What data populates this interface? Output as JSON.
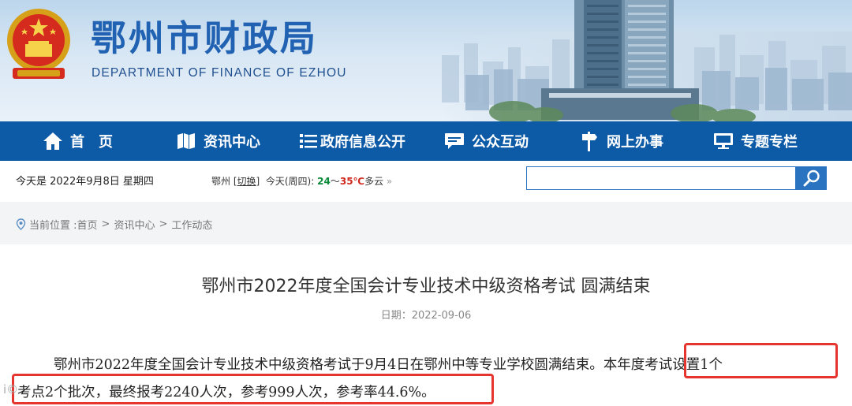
{
  "header": {
    "title": "鄂州市财政局",
    "subtitle": "DEPARTMENT OF FINANCE OF EZHOU",
    "emblem_icon": "national-emblem-icon",
    "colors": {
      "title": "#2162b2",
      "nav_bg": "#0d5aa7"
    }
  },
  "nav": {
    "items": [
      {
        "label": "首　页",
        "icon": "home-icon"
      },
      {
        "label": "资讯中心",
        "icon": "map-icon"
      },
      {
        "label": "政府信息公开",
        "icon": "list-icon"
      },
      {
        "label": "公众互动",
        "icon": "chat-icon"
      },
      {
        "label": "网上办事",
        "icon": "signpost-icon"
      },
      {
        "label": "专题专栏",
        "icon": "monitor-icon"
      }
    ]
  },
  "infobar": {
    "date": "今天是 2022年9月8日 星期四",
    "city": "鄂州",
    "switch_label": "切换",
    "weather_day": "今天(周四):",
    "temp_low": "24",
    "temp_sep": "～",
    "temp_high": "35",
    "temp_unit": "℃",
    "condition": "多云",
    "more": "»",
    "search_placeholder": ""
  },
  "breadcrumb": {
    "prefix": "当前位置 :",
    "items": [
      "首页",
      "资讯中心",
      "工作动态"
    ],
    "separator": ">"
  },
  "article": {
    "title": "鄂州市2022年度全国会计专业技术中级资格考试 圆满结束",
    "date_label": "日期：",
    "date": "2022-09-06",
    "para_line1_a": "鄂州市2022年度全国会计专业技术中级资格考试于9月4日在鄂州中等专业学校圆满结束。",
    "para_line1_b": "本年度考试设置1个",
    "para_line2": "考点2个批次，最终报考2240人次，参考999人次，参考率44.6%。"
  },
  "watermark": "i©"
}
